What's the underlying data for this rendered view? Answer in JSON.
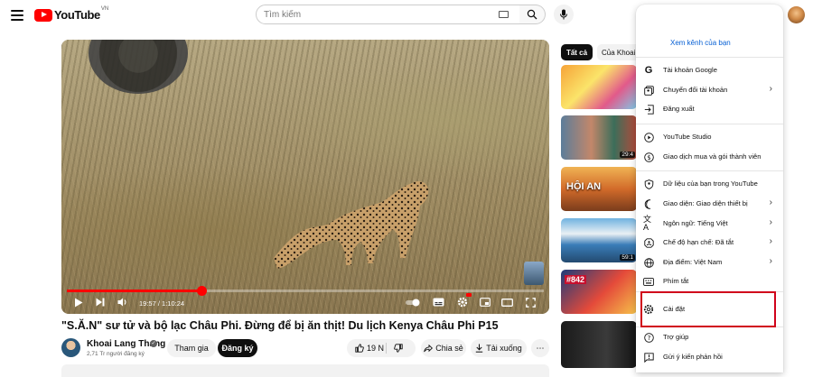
{
  "header": {
    "logo_text": "YouTube",
    "country_code": "VN",
    "search_placeholder": "Tìm kiếm"
  },
  "player": {
    "current_time": "19:57",
    "duration": "1:10:24",
    "progress_fraction": 0.283
  },
  "video": {
    "title": "\"S.Ă.N\" sư tử và bộ lạc Châu Phi. Đừng để bị ăn thịt! Du lịch Kenya Châu Phi P15",
    "channel_name": "Khoai Lang Thang",
    "subscribers": "2,71 Tr người đăng ký",
    "join_label": "Tham gia",
    "subscribe_label": "Đăng ký",
    "like_count": "19 N",
    "share_label": "Chia sẻ",
    "download_label": "Tải xuống",
    "more_label": "⋯"
  },
  "sidebar": {
    "chips": [
      "Tất cả",
      "Của Khoai Lang Thang"
    ],
    "thumbnails": [
      {
        "duration": "",
        "caption": ""
      },
      {
        "duration": "29:4",
        "caption": ""
      },
      {
        "duration": "",
        "caption": "HỘI AN"
      },
      {
        "duration": "59:1",
        "caption": ""
      },
      {
        "duration": "",
        "caption": "#842"
      },
      {
        "duration": "",
        "caption": ""
      }
    ]
  },
  "menu": {
    "view_channel": "Xem kênh của bạn",
    "items": [
      {
        "icon": "google-icon",
        "label": "Tài khoản Google",
        "chevron": false
      },
      {
        "icon": "switch-account-icon",
        "label": "Chuyển đổi tài khoản",
        "chevron": true
      },
      {
        "icon": "sign-out-icon",
        "label": "Đăng xuất",
        "chevron": false
      },
      {
        "icon": "youtube-studio-icon",
        "label": "YouTube Studio",
        "chevron": false
      },
      {
        "icon": "dollar-icon",
        "label": "Giao dịch mua và gói thành viên",
        "chevron": false
      },
      {
        "icon": "shield-user-icon",
        "label": "Dữ liệu của bạn trong YouTube",
        "chevron": false
      },
      {
        "icon": "moon-icon",
        "label": "Giao diện: Giao diện thiết bị",
        "chevron": true
      },
      {
        "icon": "translate-icon",
        "label": "Ngôn ngữ: Tiếng Việt",
        "chevron": true
      },
      {
        "icon": "restricted-icon",
        "label": "Chế độ hạn chế: Đã tắt",
        "chevron": true
      },
      {
        "icon": "globe-icon",
        "label": "Địa điểm: Việt Nam",
        "chevron": true
      },
      {
        "icon": "keyboard-icon",
        "label": "Phím tắt",
        "chevron": false
      },
      {
        "icon": "gear-icon",
        "label": "Cài đặt",
        "chevron": false
      },
      {
        "icon": "help-icon",
        "label": "Trợ giúp",
        "chevron": false
      },
      {
        "icon": "feedback-icon",
        "label": "Gửi ý kiến phản hồi",
        "chevron": false
      }
    ]
  },
  "colors": {
    "youtube_red": "#ff0000",
    "highlight_border": "#d0021b",
    "link_blue": "#065fd4"
  }
}
